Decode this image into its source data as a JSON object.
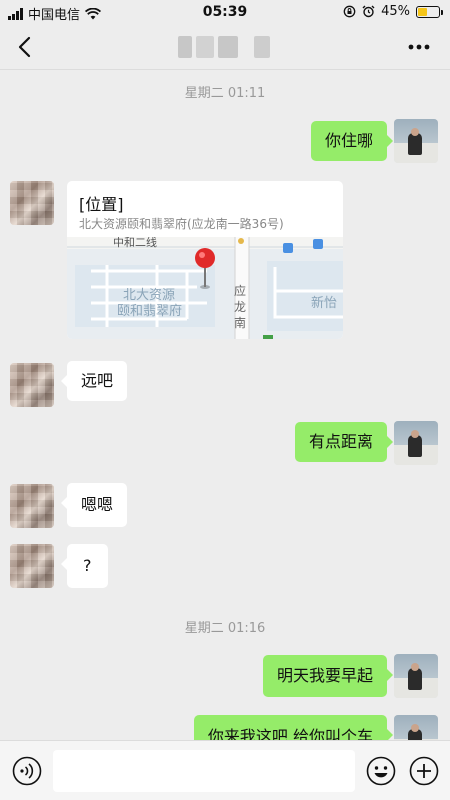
{
  "status_bar": {
    "carrier": "中国电信",
    "time": "05:39",
    "battery_text": "45%",
    "battery_level": 0.45,
    "battery_color": "#f5c518"
  },
  "nav": {
    "back_icon": "chevron-left-icon",
    "more_icon": "more-dots-icon"
  },
  "chat": {
    "timestamps": [
      "星期二 01:11",
      "星期二 01:16"
    ],
    "messages": [
      {
        "side": "out",
        "text": "你住哪"
      },
      {
        "side": "in",
        "type": "location",
        "title": "[位置]",
        "address": "北大资源颐和翡翠府(应龙南一路36号)",
        "map_labels": {
          "road_top": "中和二线",
          "poi_line1": "北大资源",
          "poi_line2": "颐和翡翠府",
          "road_vertical": "应龙南",
          "poi_right": "新怡"
        }
      },
      {
        "side": "in",
        "text": "远吧"
      },
      {
        "side": "out",
        "text": "有点距离"
      },
      {
        "side": "in",
        "text": "嗯嗯"
      },
      {
        "side": "in",
        "text": "?"
      },
      {
        "side": "out",
        "text": "明天我要早起"
      },
      {
        "side": "out",
        "text": "你来我这吧 给你叫个车"
      }
    ],
    "colors": {
      "outgoing_bubble": "#95ec69",
      "incoming_bubble": "#ffffff",
      "background": "#ededed"
    }
  },
  "input_bar": {
    "voice_icon": "voice-icon",
    "emoji_icon": "emoji-icon",
    "plus_icon": "plus-circle-icon",
    "value": ""
  }
}
